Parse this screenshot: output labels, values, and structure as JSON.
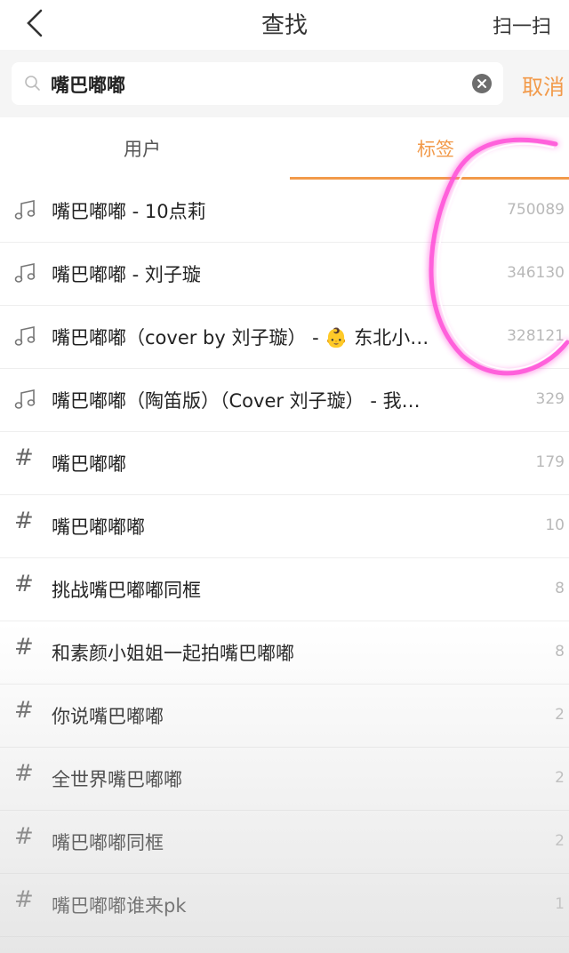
{
  "header": {
    "title": "查找",
    "scan_label": "扫一扫"
  },
  "search": {
    "value": "嘴巴嘟嘟",
    "cancel_label": "取消"
  },
  "tabs": [
    {
      "label": "用户"
    },
    {
      "label": "标签"
    }
  ],
  "results": [
    {
      "type": "music",
      "label": "嘴巴嘟嘟 - 10点莉",
      "count": "750089"
    },
    {
      "type": "music",
      "label": "嘴巴嘟嘟 - 刘子璇",
      "count": "346130"
    },
    {
      "type": "music",
      "label": "嘴巴嘟嘟（cover by 刘子璇） - 👶 东北小…",
      "count": "328121"
    },
    {
      "type": "music",
      "label": "嘴巴嘟嘟（陶笛版）（Cover 刘子璇） - 我…",
      "count": "329"
    },
    {
      "type": "hashtag",
      "label": "嘴巴嘟嘟",
      "count": "179"
    },
    {
      "type": "hashtag",
      "label": "嘴巴嘟嘟嘟",
      "count": "10"
    },
    {
      "type": "hashtag",
      "label": "挑战嘴巴嘟嘟同框",
      "count": "8"
    },
    {
      "type": "hashtag",
      "label": "和素颜小姐姐一起拍嘴巴嘟嘟",
      "count": "8"
    },
    {
      "type": "hashtag",
      "label": "你说嘴巴嘟嘟",
      "count": "2"
    },
    {
      "type": "hashtag",
      "label": "全世界嘴巴嘟嘟",
      "count": "2"
    },
    {
      "type": "hashtag",
      "label": "嘴巴嘟嘟同框",
      "count": "2"
    },
    {
      "type": "hashtag",
      "label": "嘴巴嘟嘟谁来pk",
      "count": "1"
    }
  ],
  "colors": {
    "accent": "#f29a4a",
    "count_text": "#b9b9b9",
    "scribble": "#ff4fd8"
  }
}
